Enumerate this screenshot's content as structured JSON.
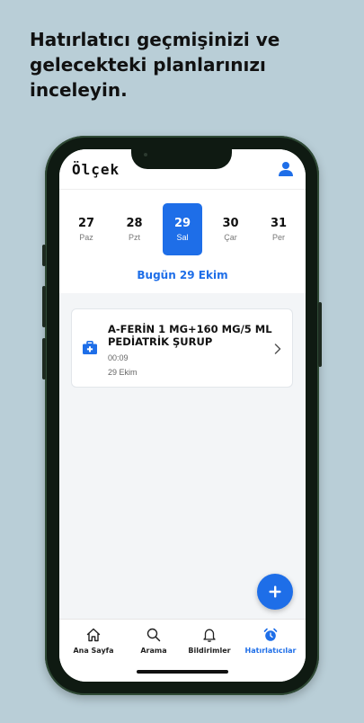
{
  "headline": "Hatırlatıcı geçmişinizi ve gelecekteki planlarınızı inceleyin.",
  "app": {
    "logo": "Ölçek"
  },
  "calendar": {
    "dates": [
      {
        "num": "27",
        "day": "Paz"
      },
      {
        "num": "28",
        "day": "Pzt"
      },
      {
        "num": "29",
        "day": "Sal"
      },
      {
        "num": "30",
        "day": "Çar"
      },
      {
        "num": "31",
        "day": "Per"
      }
    ],
    "selected_index": 2,
    "today_label": "Bugün 29 Ekim"
  },
  "reminders": [
    {
      "name": "A-FERİN 1 MG+160 MG/5 ML PEDİATRİK ŞURUP",
      "time": "00:09",
      "date": "29 Ekim"
    }
  ],
  "tabs": [
    {
      "label": "Ana Sayfa",
      "icon": "home-icon"
    },
    {
      "label": "Arama",
      "icon": "search-icon"
    },
    {
      "label": "Bildirimler",
      "icon": "bell-icon"
    },
    {
      "label": "Hatırlatıcılar",
      "icon": "alarm-clock-icon"
    }
  ],
  "active_tab_index": 3,
  "colors": {
    "accent": "#1e6ee8",
    "background": "#b9ced7"
  }
}
